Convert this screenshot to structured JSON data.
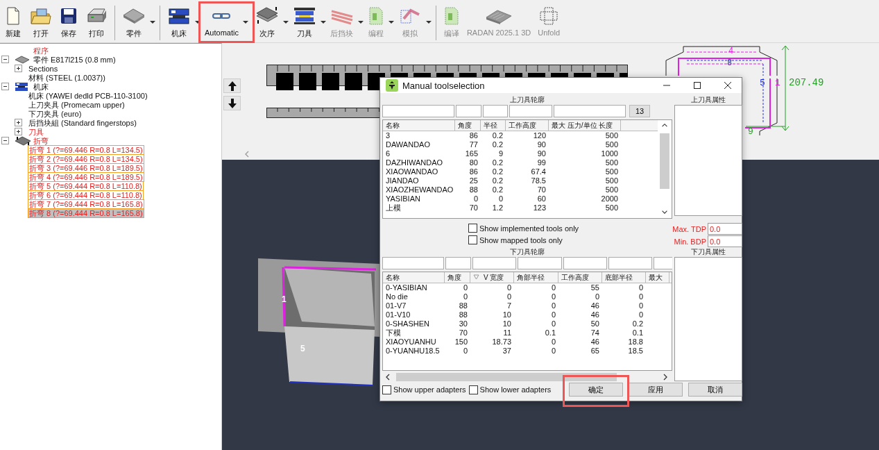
{
  "toolbar": {
    "groups": [
      {
        "items": [
          {
            "label": "新建",
            "dropdown": false,
            "disabled": false,
            "highlighted": false
          },
          {
            "label": "打开",
            "dropdown": false,
            "disabled": false,
            "highlighted": false
          },
          {
            "label": "保存",
            "dropdown": false,
            "disabled": false,
            "highlighted": false
          },
          {
            "label": "打印",
            "dropdown": false,
            "disabled": false,
            "highlighted": false
          }
        ]
      },
      {
        "items": [
          {
            "label": "零件",
            "dropdown": true,
            "disabled": false,
            "highlighted": false
          }
        ]
      },
      {
        "items": [
          {
            "label": "机床",
            "dropdown": true,
            "disabled": false,
            "highlighted": false
          },
          {
            "label": "Automatic",
            "dropdown": true,
            "disabled": false,
            "highlighted": true
          },
          {
            "label": "次序",
            "dropdown": true,
            "disabled": false,
            "highlighted": false
          },
          {
            "label": "刀具",
            "dropdown": true,
            "disabled": false,
            "highlighted": false
          },
          {
            "label": "后挡块",
            "dropdown": true,
            "disabled": true,
            "highlighted": false
          },
          {
            "label": "编程",
            "dropdown": true,
            "disabled": true,
            "highlighted": false
          },
          {
            "label": "模拟",
            "dropdown": true,
            "disabled": true,
            "highlighted": false
          }
        ]
      },
      {
        "items": [
          {
            "label": "编译",
            "dropdown": false,
            "disabled": true,
            "highlighted": false
          },
          {
            "label": "RADAN 2025.1 3D",
            "dropdown": false,
            "disabled": true,
            "highlighted": false
          },
          {
            "label": "Unfold",
            "dropdown": false,
            "disabled": true,
            "highlighted": false
          }
        ]
      }
    ]
  },
  "tree": [
    {
      "kind": "program",
      "label": "程序",
      "alert": true
    },
    {
      "kind": "part",
      "label": "零件 E817l215 (0.8 mm)",
      "alert": false,
      "expanded": true,
      "children": [
        {
          "label": "Sections",
          "alert": false,
          "expanded": false
        },
        {
          "label": "材料 (STEEL (1.0037))",
          "alert": false
        }
      ]
    },
    {
      "kind": "machine",
      "label": "机床",
      "alert": false,
      "expanded": true,
      "children": [
        {
          "label": "机床 (YAWEI dedld PCB-110-3100)",
          "alert": false
        },
        {
          "label": "上刀夹具 (Promecam upper)",
          "alert": false
        },
        {
          "label": "下刀夹具 (euro)",
          "alert": false
        },
        {
          "label": "后挡块組 (Standard fingerstops)",
          "alert": false,
          "expanded": false
        },
        {
          "label": "刀具",
          "alert": true,
          "expanded": false
        }
      ]
    },
    {
      "kind": "bends",
      "label": "折弯",
      "alert": true,
      "expanded": true,
      "children": [
        {
          "label": "折弯 1 (?=69.446 R=0.8 L=134.5)",
          "alert": true,
          "flagged": true,
          "selected": false
        },
        {
          "label": "折弯 2 (?=69.446 R=0.8 L=134.5)",
          "alert": true,
          "flagged": true,
          "selected": false
        },
        {
          "label": "折弯 3 (?=69.446 R=0.8 L=189.5)",
          "alert": true,
          "flagged": true,
          "selected": false
        },
        {
          "label": "折弯 4 (?=69.446 R=0.8 L=189.5)",
          "alert": true,
          "flagged": true,
          "selected": false
        },
        {
          "label": "折弯 5 (?=69.444 R=0.8 L=110.8)",
          "alert": true,
          "flagged": true,
          "selected": false
        },
        {
          "label": "折弯 6 (?=69.444 R=0.8 L=110.8)",
          "alert": true,
          "flagged": true,
          "selected": false
        },
        {
          "label": "折弯 7 (?=69.444 R=0.8 L=165.8)",
          "alert": true,
          "flagged": true,
          "selected": false
        },
        {
          "label": "折弯 8 (?=69.444 R=0.8 L=165.8)",
          "alert": true,
          "flagged": true,
          "selected": true
        }
      ]
    }
  ],
  "flat_pattern": {
    "labels": [
      "4",
      "8",
      "5",
      "1",
      "207.49",
      "9"
    ]
  },
  "view_3d": {
    "labels": [
      "1",
      "5"
    ]
  },
  "dialog": {
    "title": "Manual toolselection",
    "upper": {
      "heading": "上刀具轮廓",
      "count_button": "13",
      "properties_heading": "上刀具属性",
      "columns": [
        "名称",
        "角度",
        "半径",
        "工作高度",
        "最大 压力/单位 长度"
      ],
      "rows": [
        [
          "3",
          "86",
          "0.2",
          "120",
          "500"
        ],
        [
          "DAWANDAO",
          "77",
          "0.2",
          "90",
          "500"
        ],
        [
          "6",
          "165",
          "9",
          "90",
          "1000"
        ],
        [
          "DAZHIWANDAO",
          "80",
          "0.2",
          "99",
          "500"
        ],
        [
          "XIAOWANDAO",
          "86",
          "0.2",
          "67.4",
          "500"
        ],
        [
          "JIANDAO",
          "25",
          "0.2",
          "78.5",
          "500"
        ],
        [
          "XIAOZHEWANDAO",
          "88",
          "0.2",
          "70",
          "500"
        ],
        [
          "YASIBIAN",
          "0",
          "0",
          "60",
          "2000"
        ],
        [
          "上模",
          "70",
          "1.2",
          "123",
          "500"
        ]
      ]
    },
    "filters": [
      {
        "label": "Show implemented tools only",
        "checked": false
      },
      {
        "label": "Show mapped tools only",
        "checked": false
      }
    ],
    "limits": [
      {
        "label": "Max. TDP",
        "value": "0.0"
      },
      {
        "label": "Min. BDP",
        "value": "0.0"
      }
    ],
    "lower": {
      "heading": "下刀具轮廓",
      "properties_heading": "下刀具属性",
      "columns": [
        {
          "label": "名称",
          "sorted": false
        },
        {
          "label": "角度",
          "sorted": false
        },
        {
          "label": "V 宽度",
          "sorted": true
        },
        {
          "label": "角部半径",
          "sorted": false
        },
        {
          "label": "工作高度",
          "sorted": false
        },
        {
          "label": "底部半径",
          "sorted": false
        },
        {
          "label": "最大",
          "sorted": false
        }
      ],
      "rows": [
        [
          "0-YASIBIAN",
          "0",
          "0",
          "0",
          "55",
          "0"
        ],
        [
          "No die",
          "0",
          "0",
          "0",
          "0",
          "0"
        ],
        [
          "01-V7",
          "88",
          "7",
          "0",
          "46",
          "0"
        ],
        [
          "01-V10",
          "88",
          "10",
          "0",
          "46",
          "0"
        ],
        [
          "0-SHASHEN",
          "30",
          "10",
          "0",
          "50",
          "0.2"
        ],
        [
          "下模",
          "70",
          "11",
          "0.1",
          "74",
          "0.1"
        ],
        [
          "XIAOYUANHU",
          "150",
          "18.73",
          "0",
          "46",
          "18.8"
        ],
        [
          "0-YUANHU18.5",
          "0",
          "37",
          "0",
          "65",
          "18.5"
        ]
      ]
    },
    "adapters": [
      {
        "label": "Show upper adapters",
        "checked": false
      },
      {
        "label": "Show lower adapters",
        "checked": false
      }
    ],
    "buttons": [
      {
        "label": "确定",
        "highlighted": true
      },
      {
        "label": "应用",
        "highlighted": false
      },
      {
        "label": "取消",
        "highlighted": false
      }
    ]
  }
}
